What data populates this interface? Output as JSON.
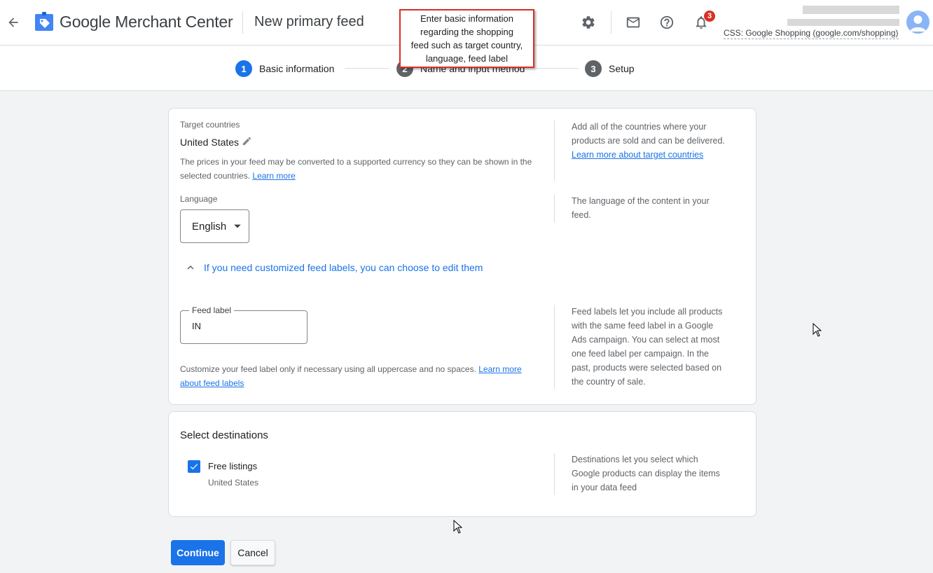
{
  "header": {
    "back_icon": "arrow-back-icon",
    "brand": "Google Merchant Center",
    "page_title": "New primary feed",
    "icons": [
      "settings-gear-icon",
      "mail-icon",
      "help-icon",
      "notifications-bell-icon"
    ],
    "notification_count": "3",
    "account_line": "CSS: Google Shopping (google.com/shopping)"
  },
  "callout": {
    "text_lines": [
      "Enter basic information",
      "regarding the shopping",
      "feed such as target country,",
      "language, feed label"
    ]
  },
  "stepper": {
    "steps": [
      {
        "number": "1",
        "label": "Basic information",
        "state": "active"
      },
      {
        "number": "2",
        "label": "Name and input method",
        "state": "inactive"
      },
      {
        "number": "3",
        "label": "Setup",
        "state": "inactive"
      }
    ]
  },
  "basic_info": {
    "target_countries_label": "Target countries",
    "target_countries_value": "United States",
    "currency_help": "The prices in your feed may be converted to a supported currency so they can be shown in the",
    "currency_help_2": "selected countries.",
    "currency_help_link": "Learn more",
    "countries_side_1": "Add all of the countries where your",
    "countries_side_2": "products are sold and can be delivered.",
    "countries_side_link": "Learn more about target countries",
    "language_label": "Language",
    "language_value": "English",
    "language_side_1": "The language of the content in your",
    "language_side_2": "feed.",
    "expander_text": "If you need customized feed labels, you can choose to edit them",
    "feed_label_label": "Feed label",
    "feed_label_value": "IN",
    "feed_label_help": "Customize your feed label only if necessary using all uppercase and no spaces.",
    "feed_label_help_link_1": "Learn more",
    "feed_label_help_link_2": "about feed labels",
    "feed_label_side": [
      "Feed labels let you include all products",
      "with the same feed label in a Google",
      "Ads campaign. You can select at most",
      "one feed label per campaign. In the",
      "past, products were selected based on",
      "the country of sale."
    ]
  },
  "destinations": {
    "title": "Select destinations",
    "free_listings_label": "Free listings",
    "free_listings_checked": true,
    "free_listings_country": "United States",
    "side": [
      "Destinations let you select which",
      "Google products can display the items",
      "in your data feed"
    ]
  },
  "buttons": {
    "continue": "Continue",
    "cancel": "Cancel"
  },
  "colors": {
    "primary": "#1a73e8",
    "step_inactive": "#5f6368",
    "badge": "#d93025",
    "callout_border": "#d93025"
  }
}
